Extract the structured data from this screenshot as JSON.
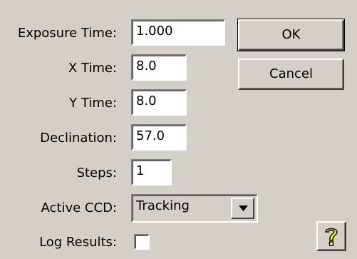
{
  "fields": {
    "exposure_time": {
      "label": "Exposure Time:",
      "value": "1.000"
    },
    "x_time": {
      "label": "X Time:",
      "value": "8.0"
    },
    "y_time": {
      "label": "Y Time:",
      "value": "8.0"
    },
    "declination": {
      "label": "Declination:",
      "value": "57.0"
    },
    "steps": {
      "label": "Steps:",
      "value": "1"
    },
    "active_ccd": {
      "label": "Active CCD:",
      "value": "Tracking"
    },
    "log_results": {
      "label": "Log Results:",
      "checked": false
    }
  },
  "buttons": {
    "ok": "OK",
    "cancel": "Cancel",
    "help_icon": "help-question-icon"
  },
  "colors": {
    "dialog_bg": "#d4d0c8",
    "help_icon_fill": "#ffff00"
  }
}
